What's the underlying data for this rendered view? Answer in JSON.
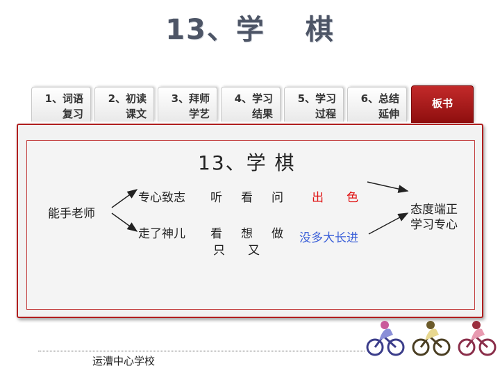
{
  "title": "13、学　 棋",
  "tabs": [
    {
      "line1": "1、词语",
      "line2": "复习"
    },
    {
      "line1": "2、初读",
      "line2": "课文"
    },
    {
      "line1": "3、拜师",
      "line2": "学艺"
    },
    {
      "line1": "4、学习",
      "line2": "结果"
    },
    {
      "line1": "5、学习",
      "line2": "过程"
    },
    {
      "line1": "6、总结",
      "line2": "延伸"
    },
    {
      "line1": "板书"
    }
  ],
  "board": {
    "title": "13、学  棋",
    "left_label": "能手老师",
    "row1": {
      "label": "专心致志",
      "words": [
        "听",
        "看",
        "问"
      ],
      "result_a": "出",
      "result_b": "色"
    },
    "row2": {
      "label": "走了神儿",
      "words": [
        "看",
        "想",
        "做"
      ],
      "words_below": [
        "只",
        "又"
      ],
      "result": "没多大长进"
    },
    "conclusion": [
      "态度端正",
      "学习专心"
    ],
    "colors": {
      "highlight_red": "#e01010",
      "highlight_blue": "#3a5fd8",
      "accent": "#b01e1e"
    }
  },
  "footer": {
    "school": "运漕中心学校"
  },
  "decor": [
    "cyclist-icon-blue",
    "cyclist-icon-yellow",
    "cyclist-icon-pink"
  ]
}
